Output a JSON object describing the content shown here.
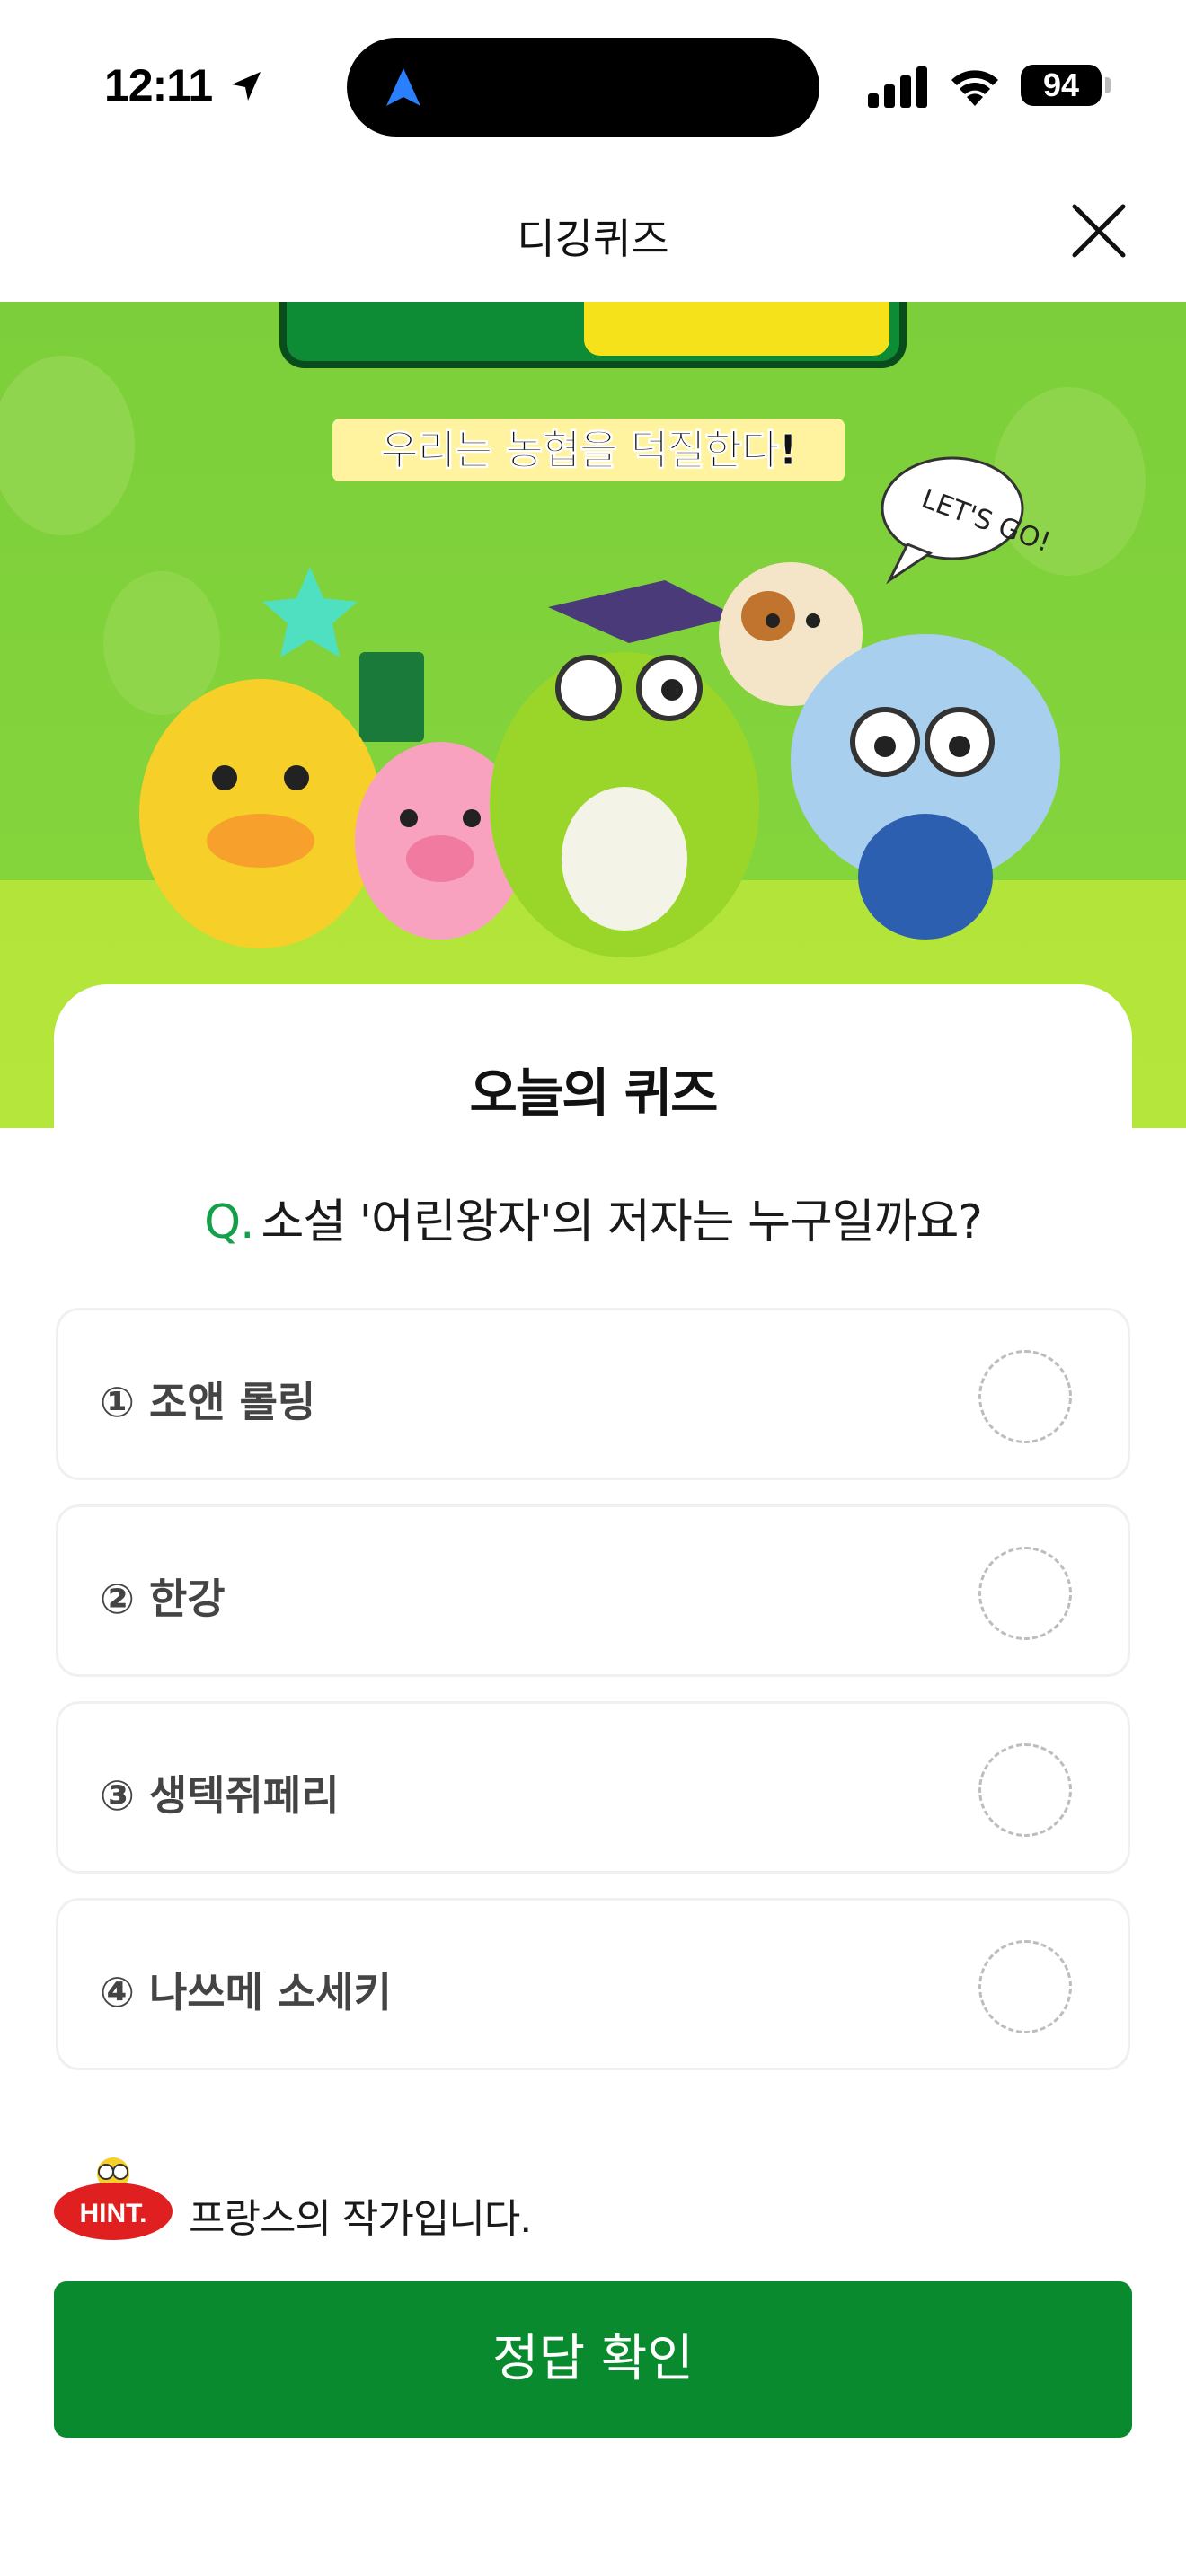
{
  "status_bar": {
    "time": "12:11",
    "battery": "94"
  },
  "header": {
    "title": "디깅퀴즈"
  },
  "banner": {
    "subtitle": "우리는 농협을 덕질한다!",
    "bubble_text": "LET'S GO!"
  },
  "quiz": {
    "section_title": "오늘의 퀴즈",
    "question_prefix": "Q.",
    "question": "소설 '어린왕자'의 저자는 누구일까요?",
    "options": [
      {
        "label": "① 조앤 롤링"
      },
      {
        "label": "② 한강"
      },
      {
        "label": "③ 생텍쥐페리"
      },
      {
        "label": "④ 나쓰메 소세키"
      }
    ],
    "hint_badge": "HINT.",
    "hint_text": "프랑스의 작가입니다.",
    "submit_label": "정답 확인"
  },
  "colors": {
    "primary_green": "#0a8a2e",
    "accent_green": "#14a04a",
    "hint_red": "#e02020",
    "banner_green": "#7ccf3a"
  },
  "icons": {
    "close": "close-icon",
    "location": "location-arrow-icon",
    "signal": "cellular-signal-icon",
    "wifi": "wifi-icon",
    "battery": "battery-icon"
  }
}
